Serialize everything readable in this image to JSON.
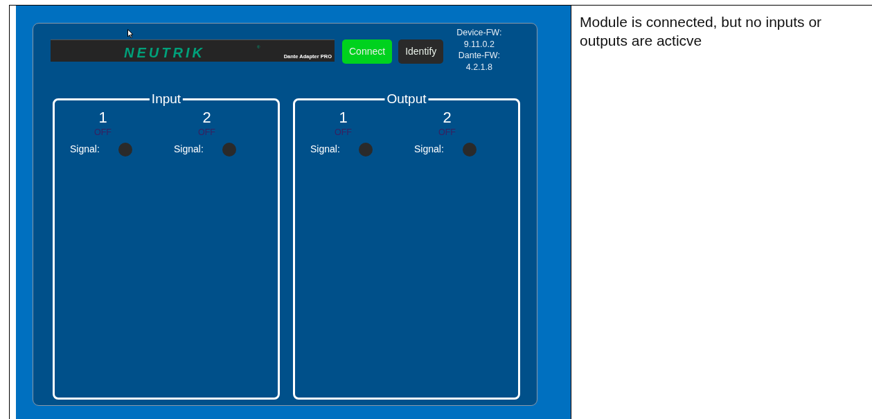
{
  "header": {
    "logo": "NEUTRIK",
    "logo_mark": "®",
    "logo_subtitle": "Dante Adapter PRO",
    "buttons": [
      {
        "label": "Connect",
        "active": true
      },
      {
        "label": "Identify",
        "active": false
      }
    ],
    "firmware": [
      {
        "label": "Device-FW:",
        "value": "9.11.0.2"
      },
      {
        "label": "Dante-FW:",
        "value": "4.2.1.8"
      }
    ]
  },
  "groups": [
    {
      "title": "Input",
      "channels": [
        {
          "number": "1",
          "status": "OFF",
          "on": false,
          "signal_label": "Signal:",
          "signal": false
        },
        {
          "number": "2",
          "status": "OFF",
          "on": false,
          "signal_label": "Signal:",
          "signal": false
        }
      ]
    },
    {
      "title": "Output",
      "channels": [
        {
          "number": "1",
          "status": "OFF",
          "on": false,
          "signal_label": "Signal:",
          "signal": false
        },
        {
          "number": "2",
          "status": "OFF",
          "on": false,
          "signal_label": "Signal:",
          "signal": false
        }
      ]
    }
  ],
  "caption": "Module is connected, but no inputs or outputs are acticve"
}
